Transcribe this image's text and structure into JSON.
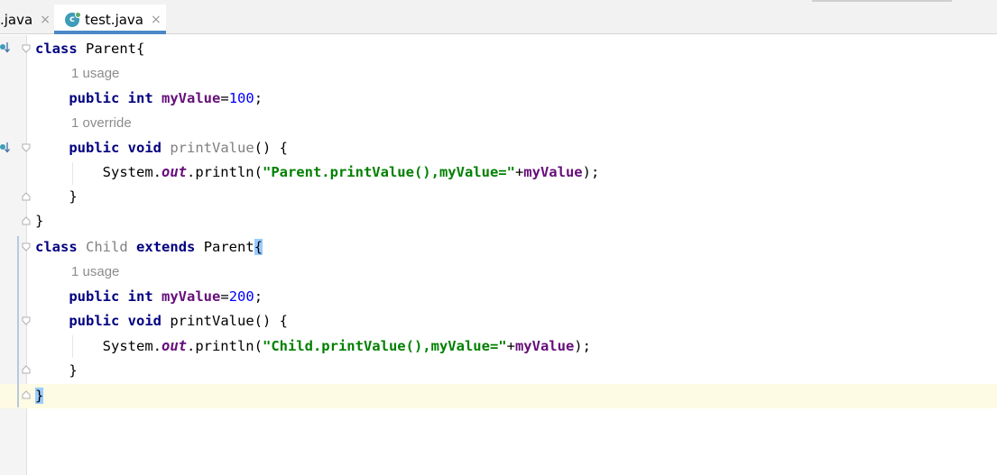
{
  "tabs": [
    {
      "label": ".java",
      "close": "×",
      "active": false
    },
    {
      "label": "test.java",
      "close": "×",
      "active": true,
      "icon": "class-icon"
    }
  ],
  "hints": {
    "usage_parent_field": "1 usage",
    "override": "1 override",
    "usage_child_field": "1 usage"
  },
  "code": {
    "l1_kw": "class",
    "l1_rest": " Parent{",
    "l2_kw1": "public",
    "l2_kw2": "int",
    "l2_field": "myValue",
    "l2_eq": "=",
    "l2_num": "100",
    "l2_semi": ";",
    "l3_kw1": "public",
    "l3_kw2": "void",
    "l3_name": "printValue",
    "l3_rest": "() {",
    "l4_a": "System.",
    "l4_out": "out",
    "l4_b": ".println(",
    "l4_str": "\"Parent.printValue(),myValue=\"",
    "l4_plus": "+",
    "l4_field": "myValue",
    "l4_end": ");",
    "l5": "}",
    "l6": "}",
    "l7_kw": "class",
    "l7_name": "Child",
    "l7_kw2": "extends",
    "l7_rest": " Parent",
    "l7_brace": "{",
    "l8_kw1": "public",
    "l8_kw2": "int",
    "l8_field": "myValue",
    "l8_eq": "=",
    "l8_num": "200",
    "l8_semi": ";",
    "l9_kw1": "public",
    "l9_kw2": "void",
    "l9_rest": " printValue() {",
    "l10_a": "System.",
    "l10_out": "out",
    "l10_b": ".println(",
    "l10_str": "\"Child.printValue(),myValue=\"",
    "l10_plus": "+",
    "l10_field": "myValue",
    "l10_end": ");",
    "l11": "}",
    "l12": "}"
  },
  "colors": {
    "keyword": "#000080",
    "field": "#660e7a",
    "number": "#0000ff",
    "string": "#008000",
    "hint": "#8c8c8c",
    "tab_underline": "#4a88c7",
    "current_line": "#fdfbe3"
  }
}
